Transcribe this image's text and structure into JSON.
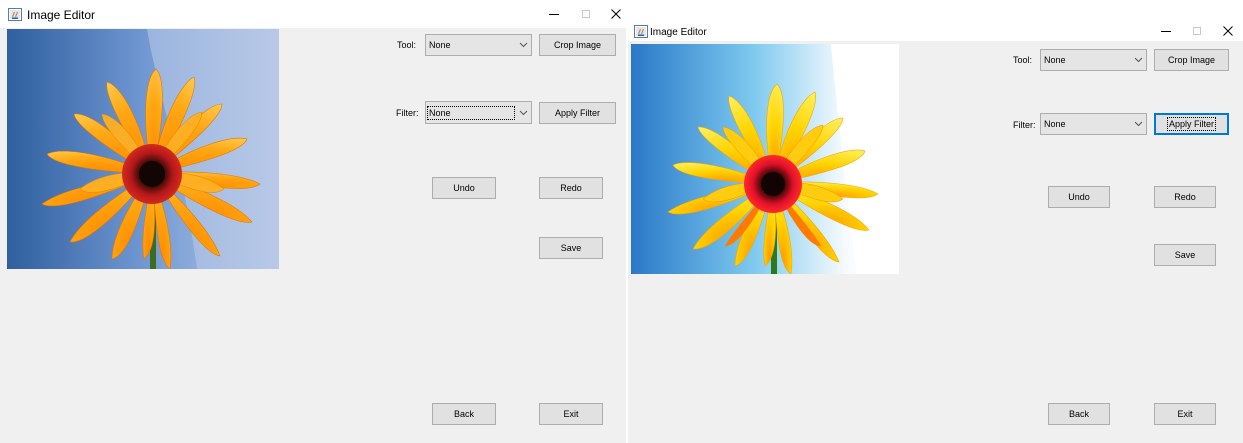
{
  "windows": [
    {
      "title": "Image Editor",
      "tool_label": "Tool:",
      "tool_value": "None",
      "filter_label": "Filter:",
      "filter_value": "None",
      "buttons": {
        "crop": "Crop Image",
        "apply_filter": "Apply Filter",
        "undo": "Undo",
        "redo": "Redo",
        "save": "Save",
        "back": "Back",
        "exit": "Exit"
      },
      "image_variant": "original"
    },
    {
      "title": "Image Editor",
      "tool_label": "Tool:",
      "tool_value": "None",
      "filter_label": "Filter:",
      "filter_value": "None",
      "buttons": {
        "crop": "Crop Image",
        "apply_filter": "Apply Filter",
        "undo": "Undo",
        "redo": "Redo",
        "save": "Save",
        "back": "Back",
        "exit": "Exit"
      },
      "image_variant": "brightened"
    }
  ],
  "icons": {
    "app": "java-app-icon",
    "minimize": "minimize-icon",
    "maximize": "maximize-icon",
    "close": "close-icon",
    "dropdown": "chevron-down-icon"
  },
  "colors": {
    "window_bg": "#f0f0f0",
    "button_bg": "#e1e1e1",
    "focus_blue": "#0078d7"
  }
}
